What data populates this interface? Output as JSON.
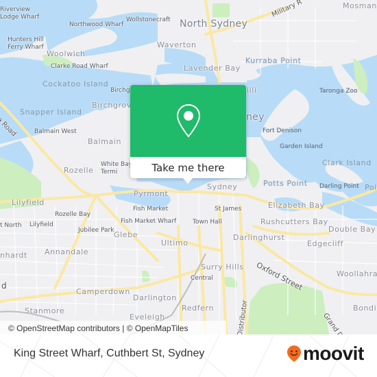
{
  "map": {
    "colors": {
      "water": "#b8dcf7",
      "land": "#f0f0f2",
      "park": "#cdeebf",
      "road_major": "#fbe8a2",
      "road_minor": "#ffffff"
    },
    "labels": {
      "riverview": "Riverview\nLodge Wharf",
      "northwood_wharf": "Northwood Wharf",
      "wollstonecraft": "Wollstonecraft",
      "north_sydney": "North Sydney",
      "military_road": "Military R",
      "mosman": "Mosman",
      "hunters_hill": "Hunters Hill\nFerry Wharf",
      "woolwich": "Woolwich",
      "waverton": "Waverton",
      "clarke_road_wharf": "Clarke Road Wharf",
      "lavender_bay": "Lavender Bay",
      "kurraba_point": "Kurraba Point",
      "cockatoo_island": "Cockatoo Island",
      "birchgrove_wharf": "Birchg",
      "milsons": "illi",
      "taronga_zoo": "Taronga Zoo",
      "victoria_road": "oria Road",
      "snapper_island": "Snapper Island",
      "birchgrove": "Birchgrove",
      "sydney_harbour": "ney",
      "balmain_west": "Balmain West",
      "balmain": "Balmain",
      "fort_denison": "Fort Denison",
      "garden_island": "Garden Island",
      "white_bay": "White Bay\nTermi",
      "rozelle": "Rozelle",
      "clark_island": "Clark Island",
      "potts_point": "Potts Point",
      "darling_point": "Darling Point",
      "point_edge": "Poi",
      "lilyfield": "Lilyfield",
      "pyrmont": "Pyrmont",
      "sydney": "Sydney",
      "elizabeth_bay": "Elizabeth Bay",
      "fish_market": "Fish Market",
      "st_james": "St James",
      "rozelle_bay": "Rozelle Bay",
      "fish_market_wharf": "Fish Market Wharf",
      "town_hall": "Town Hall",
      "rushcutters_bay": "Rushcutters Bay",
      "lilyfield_stop": "Lilyfield",
      "double_bay": "Double Bay",
      "port_north": "t North",
      "jubilee_park": "Jubilee Park",
      "glebe": "Glebe",
      "darlinghurst": "Darlinghurst",
      "ultimo": "Ultimo",
      "edgecliff": "Edgecliff",
      "leichhardt": "nhardt",
      "annandale": "Annandale",
      "surry_hills": "Surry Hills",
      "oxford_street": "Oxford Street",
      "central": "Central",
      "woollahra": "Woollahra",
      "parramatta_road": "d",
      "camperdown": "Camperdown",
      "darlington": "Darlington",
      "redfern": "Redfern",
      "bondi": "Bondi J",
      "stanmore": "Stanmore",
      "eveleigh": "Eveleigh",
      "distributor": "Distributor",
      "grand_drive": "Grand D"
    },
    "popup": {
      "icon": "map-pin-icon",
      "cta_label": "Take me there"
    },
    "attribution": "© OpenStreetMap contributors | © OpenMapTiles"
  },
  "footer": {
    "place_name": "King Street Wharf, Cuthbert St, Sydney",
    "logo_text": "moovit",
    "logo_color": "#f46b1f"
  }
}
